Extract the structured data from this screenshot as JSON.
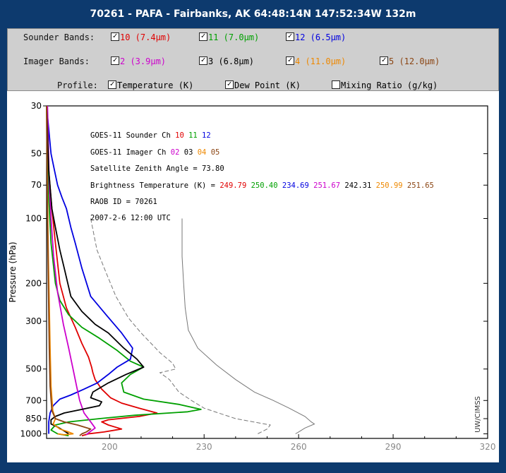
{
  "title": "70261 - PAFA - Fairbanks, AK 64:48:14N 147:52:34W 132m",
  "controls": {
    "sounder": {
      "label": "Sounder Bands:",
      "options": [
        {
          "label": "10 (7.4μm)",
          "checked": true,
          "color": "#e00000"
        },
        {
          "label": "11 (7.0μm)",
          "checked": true,
          "color": "#00a000"
        },
        {
          "label": "12 (6.5μm)",
          "checked": true,
          "color": "#0000e0"
        }
      ]
    },
    "imager": {
      "label": "Imager  Bands:",
      "options": [
        {
          "label": "2 (3.9μm)",
          "checked": true,
          "color": "#cc00cc"
        },
        {
          "label": "3 (6.8μm)",
          "checked": true,
          "color": "#000000"
        },
        {
          "label": "4 (11.0μm)",
          "checked": true,
          "color": "#ee8800"
        },
        {
          "label": "5 (12.0μm)",
          "checked": true,
          "color": "#8b4513"
        }
      ]
    },
    "profile": {
      "label": "Profile:",
      "options": [
        {
          "label": "Temperature (K)",
          "checked": true
        },
        {
          "label": "Dew Point (K)",
          "checked": true
        },
        {
          "label": "Mixing Ratio (g/kg)",
          "checked": false
        }
      ]
    }
  },
  "watermark": "UW/CIMSS",
  "chart_data": {
    "type": "line",
    "ylabel": "Pressure (hPa)",
    "yscale": "log",
    "ylim": [
      1050,
      30
    ],
    "yticks": [
      30,
      50,
      70,
      100,
      200,
      300,
      500,
      700,
      850,
      1000
    ],
    "xlim": [
      180,
      320
    ],
    "xticks": [
      200,
      230,
      260,
      290,
      320
    ],
    "annotations": {
      "sounder_line": {
        "prefix": "GOES-11 Sounder Ch",
        "channels": [
          "10",
          "11",
          "12"
        ]
      },
      "imager_line": {
        "prefix": "GOES-11 Imager  Ch",
        "channels": [
          "02",
          "03",
          "04",
          "05"
        ]
      },
      "zenith": "Satellite Zenith Angle = 73.80",
      "bt_prefix": "Brightness Temperature (K) =",
      "bt_values": [
        "249.79",
        "250.40",
        "234.69",
        "251.67",
        "242.31",
        "250.99",
        "251.65"
      ],
      "raob": "RAOB ID = 70261",
      "date": "2007-2-6 12:00 UTC"
    },
    "temperature": {
      "color": "#777777",
      "points": [
        [
          223,
          100
        ],
        [
          223,
          150
        ],
        [
          223.5,
          200
        ],
        [
          224,
          260
        ],
        [
          225,
          330
        ],
        [
          228,
          400
        ],
        [
          234,
          480
        ],
        [
          240,
          560
        ],
        [
          246,
          640
        ],
        [
          252,
          700
        ],
        [
          257,
          760
        ],
        [
          262,
          830
        ],
        [
          264,
          880
        ],
        [
          265,
          900
        ],
        [
          262,
          940
        ],
        [
          260,
          980
        ],
        [
          259,
          1000
        ]
      ]
    },
    "dewpoint": {
      "color": "#777777",
      "points": [
        [
          194,
          100
        ],
        [
          196,
          140
        ],
        [
          199,
          180
        ],
        [
          202,
          230
        ],
        [
          206,
          290
        ],
        [
          210,
          340
        ],
        [
          216,
          420
        ],
        [
          220,
          470
        ],
        [
          221,
          500
        ],
        [
          216,
          520
        ],
        [
          219,
          560
        ],
        [
          222,
          640
        ],
        [
          226,
          700
        ],
        [
          230,
          760
        ],
        [
          240,
          850
        ],
        [
          251,
          910
        ],
        [
          250,
          950
        ],
        [
          247,
          1000
        ]
      ]
    },
    "series": [
      {
        "channel": "10",
        "color": "#e00000",
        "points": [
          [
            0.0,
            30
          ],
          [
            0.5,
            60
          ],
          [
            1.2,
            90
          ],
          [
            2.0,
            130
          ],
          [
            3.0,
            200
          ],
          [
            4.5,
            260
          ],
          [
            6.5,
            320
          ],
          [
            8.0,
            380
          ],
          [
            9.5,
            440
          ],
          [
            10.2,
            490
          ],
          [
            10.5,
            520
          ],
          [
            11.0,
            560
          ],
          [
            12.5,
            620
          ],
          [
            14.5,
            680
          ],
          [
            17.0,
            720
          ],
          [
            21.0,
            760
          ],
          [
            25.0,
            800
          ],
          [
            21.0,
            830
          ],
          [
            14.0,
            860
          ],
          [
            12.5,
            880
          ],
          [
            14.0,
            910
          ],
          [
            17.0,
            950
          ],
          [
            13.0,
            980
          ],
          [
            9.5,
            1000
          ],
          [
            8.0,
            1020
          ]
        ]
      },
      {
        "channel": "11",
        "color": "#00a000",
        "points": [
          [
            0.0,
            30
          ],
          [
            0.2,
            50
          ],
          [
            0.5,
            80
          ],
          [
            1.0,
            130
          ],
          [
            2.0,
            200
          ],
          [
            3.0,
            240
          ],
          [
            5.0,
            280
          ],
          [
            8.0,
            320
          ],
          [
            12.0,
            360
          ],
          [
            16.0,
            410
          ],
          [
            19.0,
            460
          ],
          [
            22.0,
            490
          ],
          [
            19.0,
            530
          ],
          [
            17.0,
            580
          ],
          [
            17.5,
            640
          ],
          [
            22.0,
            690
          ],
          [
            30.0,
            730
          ],
          [
            35.0,
            770
          ],
          [
            32.0,
            790
          ],
          [
            20.0,
            820
          ],
          [
            12.0,
            850
          ],
          [
            5.0,
            880
          ],
          [
            2.0,
            910
          ],
          [
            1.0,
            960
          ],
          [
            2.5,
            1000
          ],
          [
            5.0,
            1020
          ]
        ]
      },
      {
        "channel": "12",
        "color": "#0000e0",
        "points": [
          [
            0.0,
            30
          ],
          [
            1.0,
            50
          ],
          [
            1.8,
            60
          ],
          [
            2.5,
            70
          ],
          [
            3.5,
            80
          ],
          [
            4.5,
            90
          ],
          [
            5.5,
            110
          ],
          [
            6.5,
            130
          ],
          [
            8.0,
            170
          ],
          [
            10.0,
            230
          ],
          [
            13.5,
            280
          ],
          [
            17.0,
            340
          ],
          [
            19.5,
            400
          ],
          [
            19.0,
            450
          ],
          [
            16.0,
            490
          ],
          [
            14.0,
            530
          ],
          [
            11.5,
            580
          ],
          [
            8.5,
            620
          ],
          [
            5.5,
            660
          ],
          [
            3.0,
            690
          ],
          [
            1.5,
            740
          ],
          [
            0.8,
            800
          ],
          [
            0.5,
            880
          ],
          [
            0.5,
            1000
          ]
        ]
      },
      {
        "channel": "02",
        "color": "#cc00cc",
        "points": [
          [
            0.2,
            30
          ],
          [
            0.6,
            70
          ],
          [
            1.0,
            100
          ],
          [
            1.6,
            150
          ],
          [
            2.5,
            220
          ],
          [
            3.8,
            310
          ],
          [
            5.0,
            400
          ],
          [
            6.0,
            500
          ],
          [
            6.8,
            600
          ],
          [
            7.5,
            700
          ],
          [
            8.5,
            800
          ],
          [
            10.0,
            880
          ],
          [
            11.0,
            940
          ],
          [
            9.5,
            990
          ],
          [
            9.0,
            1010
          ]
        ]
      },
      {
        "channel": "03",
        "color": "#000000",
        "points": [
          [
            0.0,
            30
          ],
          [
            0.5,
            60
          ],
          [
            1.2,
            90
          ],
          [
            2.0,
            110
          ],
          [
            3.0,
            140
          ],
          [
            4.0,
            170
          ],
          [
            5.5,
            230
          ],
          [
            8.0,
            270
          ],
          [
            11.0,
            310
          ],
          [
            14.0,
            340
          ],
          [
            17.5,
            400
          ],
          [
            20.5,
            450
          ],
          [
            22.0,
            490
          ],
          [
            18.0,
            530
          ],
          [
            14.0,
            580
          ],
          [
            10.5,
            640
          ],
          [
            10.0,
            680
          ],
          [
            12.5,
            710
          ],
          [
            12.0,
            740
          ],
          [
            8.0,
            770
          ],
          [
            4.0,
            800
          ],
          [
            2.0,
            830
          ],
          [
            1.0,
            860
          ],
          [
            1.0,
            900
          ],
          [
            2.5,
            930
          ],
          [
            4.0,
            970
          ],
          [
            5.0,
            1000
          ]
        ]
      },
      {
        "channel": "04",
        "color": "#ee8800",
        "points": [
          [
            0.0,
            30
          ],
          [
            0.2,
            80
          ],
          [
            0.4,
            150
          ],
          [
            0.6,
            250
          ],
          [
            0.8,
            400
          ],
          [
            1.0,
            600
          ],
          [
            1.4,
            780
          ],
          [
            2.0,
            850
          ],
          [
            1.5,
            900
          ],
          [
            3.0,
            950
          ],
          [
            5.0,
            980
          ],
          [
            6.0,
            1000
          ],
          [
            4.0,
            1010
          ],
          [
            2.5,
            1000
          ]
        ]
      },
      {
        "channel": "05",
        "color": "#8b4513",
        "points": [
          [
            0.0,
            30
          ],
          [
            0.2,
            100
          ],
          [
            0.4,
            200
          ],
          [
            0.6,
            400
          ],
          [
            0.8,
            600
          ],
          [
            1.2,
            780
          ],
          [
            2.0,
            850
          ],
          [
            4.0,
            880
          ],
          [
            7.0,
            910
          ],
          [
            10.0,
            950
          ],
          [
            9.0,
            980
          ],
          [
            8.0,
            1000
          ],
          [
            7.5,
            1020
          ]
        ]
      }
    ],
    "weighting_note": "Weighting-function curves use the relative x scale 0-100 across the plot width (no printed units)."
  }
}
